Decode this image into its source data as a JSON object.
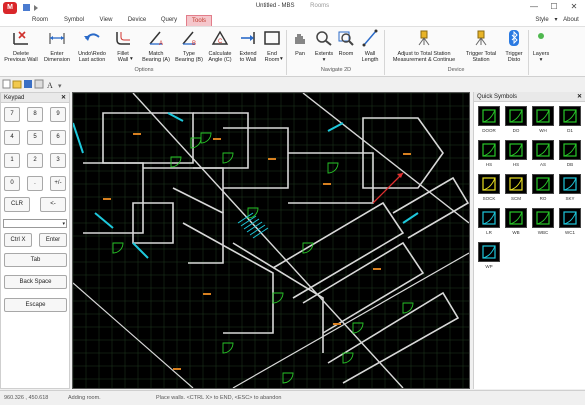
{
  "window": {
    "title": "Untitled - MBS",
    "context_title": "Rooms",
    "logo_text": "M",
    "controls": [
      "—",
      "☐",
      "✕"
    ]
  },
  "tabs": [
    "Room",
    "Symbol",
    "View",
    "Device",
    "Query",
    "Tools"
  ],
  "active_tab": "Tools",
  "right_menu": {
    "style": "Style",
    "about": "About"
  },
  "ribbon": {
    "buttons": [
      {
        "id": "delete-previous-wall",
        "label": "Delete\nPrevious Wall"
      },
      {
        "id": "enter-dimension",
        "label": "Enter\nDimension"
      },
      {
        "id": "undo-redo",
        "label": "Undo\\Redo\nLast action"
      },
      {
        "id": "fillet-wall",
        "label": "Fillet\nWall"
      },
      {
        "id": "match-bearing",
        "label": "Match\nBearing (A)"
      },
      {
        "id": "type-bearing",
        "label": "Type\nBearing (B)"
      },
      {
        "id": "calculate-angle",
        "label": "Calculate\nAngle (C)"
      },
      {
        "id": "extend-to-wall",
        "label": "Extend\nto Wall"
      },
      {
        "id": "end-room",
        "label": "End\nRoom"
      },
      {
        "id": "pan",
        "label": "Pan"
      },
      {
        "id": "extents",
        "label": "Extents"
      },
      {
        "id": "room",
        "label": "Room"
      },
      {
        "id": "wall-length",
        "label": "Wall\nLength"
      },
      {
        "id": "adjust-total-station",
        "label": "Adjust to Total Station\nMeasurement & Continue"
      },
      {
        "id": "trigger-total-station",
        "label": "Trigger Total\nStation"
      },
      {
        "id": "trigger-disto",
        "label": "Trigger\nDisto"
      },
      {
        "id": "layers",
        "label": "Layers"
      }
    ],
    "groups": [
      "Options",
      "Navigate 2D",
      "Device"
    ]
  },
  "keypad": {
    "title": "Keypad",
    "close": "✕",
    "keys": [
      "7",
      "8",
      "9",
      "4",
      "5",
      "6",
      "1",
      "2",
      "3",
      "0",
      ".",
      "+/-"
    ],
    "clr": "CLR",
    "back": "<-",
    "ctrlx": "Ctrl X",
    "enter": "Enter",
    "tab": "Tab",
    "backspace": "Back Space",
    "escape": "Escape"
  },
  "quick_symbols": {
    "title": "Quick Symbols",
    "close": "✕",
    "items": [
      "DOOR",
      "DO",
      "WH",
      "D1",
      "HS",
      "HS",
      "AS",
      "DB",
      "SOCK",
      "SCM",
      "RO",
      "SKY",
      "LR",
      "WB",
      "WBC",
      "WC1",
      "WP"
    ]
  },
  "status": {
    "coords": "960.326 , 450.618",
    "mode": "Adding room.",
    "hint": "Place walls. <CTRL X> to END, <ESC> to abandon"
  },
  "colors": {
    "accent": "#e27d8a",
    "canvas_bg": "#000000",
    "wall": "#d8d8d8",
    "door": "#28c828",
    "cyan": "#1ec8dc"
  }
}
